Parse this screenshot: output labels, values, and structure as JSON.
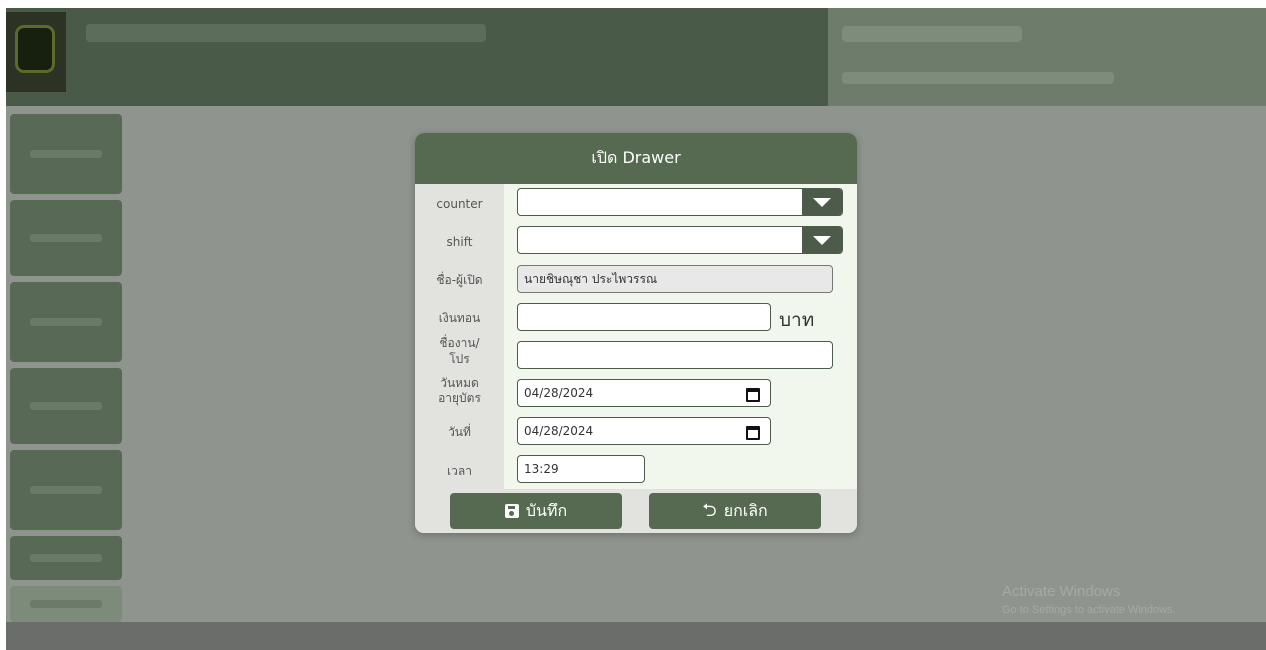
{
  "modal": {
    "title": "เปิด Drawer",
    "fields": {
      "counter": {
        "label": "counter",
        "value": ""
      },
      "shift": {
        "label": "shift",
        "value": ""
      },
      "opener_name": {
        "label": "ชื่อ-ผู้เปิด",
        "value": "นายชิษณุชา ประไพวรรณ"
      },
      "change_money": {
        "label": "เงินทอน",
        "value": "",
        "unit": "บาท"
      },
      "event_name": {
        "label_line1": "ชื่องาน/",
        "label_line2": "โปร",
        "value": ""
      },
      "card_expiry": {
        "label_line1": "วันหมด",
        "label_line2": "อายุบัตร",
        "value": "04/28/2024"
      },
      "date": {
        "label": "วันที่",
        "value": "04/28/2024"
      },
      "time": {
        "label": "เวลา",
        "value": "13:29"
      }
    },
    "buttons": {
      "save_label": "บันทึก",
      "cancel_label": "ยกเลิก"
    }
  },
  "watermark": {
    "line1": "Activate Windows",
    "line2": "Go to Settings to activate Windows."
  },
  "icons": {
    "counter_dropdown": "caret-down-icon",
    "shift_dropdown": "caret-down-icon",
    "calendar": "calendar-icon",
    "save": "floppy-disk-icon",
    "cancel": "undo-arrow-icon"
  },
  "colors": {
    "accent": "#566a51",
    "modal_bg": "#f2f7ee",
    "label_bg": "#e2e2df",
    "overlay": "#8f958e"
  }
}
